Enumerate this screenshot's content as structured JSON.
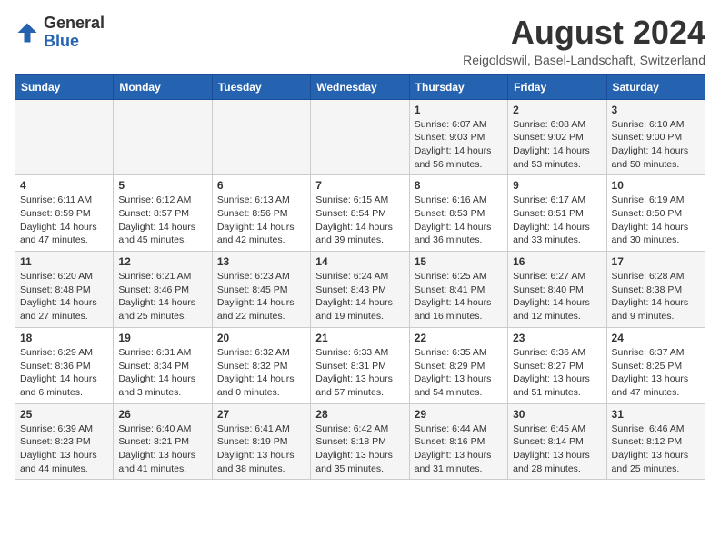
{
  "header": {
    "logo_general": "General",
    "logo_blue": "Blue",
    "month_title": "August 2024",
    "subtitle": "Reigoldswil, Basel-Landschaft, Switzerland"
  },
  "days_of_week": [
    "Sunday",
    "Monday",
    "Tuesday",
    "Wednesday",
    "Thursday",
    "Friday",
    "Saturday"
  ],
  "weeks": [
    [
      {
        "day": "",
        "info": ""
      },
      {
        "day": "",
        "info": ""
      },
      {
        "day": "",
        "info": ""
      },
      {
        "day": "",
        "info": ""
      },
      {
        "day": "1",
        "info": "Sunrise: 6:07 AM\nSunset: 9:03 PM\nDaylight: 14 hours and 56 minutes."
      },
      {
        "day": "2",
        "info": "Sunrise: 6:08 AM\nSunset: 9:02 PM\nDaylight: 14 hours and 53 minutes."
      },
      {
        "day": "3",
        "info": "Sunrise: 6:10 AM\nSunset: 9:00 PM\nDaylight: 14 hours and 50 minutes."
      }
    ],
    [
      {
        "day": "4",
        "info": "Sunrise: 6:11 AM\nSunset: 8:59 PM\nDaylight: 14 hours and 47 minutes."
      },
      {
        "day": "5",
        "info": "Sunrise: 6:12 AM\nSunset: 8:57 PM\nDaylight: 14 hours and 45 minutes."
      },
      {
        "day": "6",
        "info": "Sunrise: 6:13 AM\nSunset: 8:56 PM\nDaylight: 14 hours and 42 minutes."
      },
      {
        "day": "7",
        "info": "Sunrise: 6:15 AM\nSunset: 8:54 PM\nDaylight: 14 hours and 39 minutes."
      },
      {
        "day": "8",
        "info": "Sunrise: 6:16 AM\nSunset: 8:53 PM\nDaylight: 14 hours and 36 minutes."
      },
      {
        "day": "9",
        "info": "Sunrise: 6:17 AM\nSunset: 8:51 PM\nDaylight: 14 hours and 33 minutes."
      },
      {
        "day": "10",
        "info": "Sunrise: 6:19 AM\nSunset: 8:50 PM\nDaylight: 14 hours and 30 minutes."
      }
    ],
    [
      {
        "day": "11",
        "info": "Sunrise: 6:20 AM\nSunset: 8:48 PM\nDaylight: 14 hours and 27 minutes."
      },
      {
        "day": "12",
        "info": "Sunrise: 6:21 AM\nSunset: 8:46 PM\nDaylight: 14 hours and 25 minutes."
      },
      {
        "day": "13",
        "info": "Sunrise: 6:23 AM\nSunset: 8:45 PM\nDaylight: 14 hours and 22 minutes."
      },
      {
        "day": "14",
        "info": "Sunrise: 6:24 AM\nSunset: 8:43 PM\nDaylight: 14 hours and 19 minutes."
      },
      {
        "day": "15",
        "info": "Sunrise: 6:25 AM\nSunset: 8:41 PM\nDaylight: 14 hours and 16 minutes."
      },
      {
        "day": "16",
        "info": "Sunrise: 6:27 AM\nSunset: 8:40 PM\nDaylight: 14 hours and 12 minutes."
      },
      {
        "day": "17",
        "info": "Sunrise: 6:28 AM\nSunset: 8:38 PM\nDaylight: 14 hours and 9 minutes."
      }
    ],
    [
      {
        "day": "18",
        "info": "Sunrise: 6:29 AM\nSunset: 8:36 PM\nDaylight: 14 hours and 6 minutes."
      },
      {
        "day": "19",
        "info": "Sunrise: 6:31 AM\nSunset: 8:34 PM\nDaylight: 14 hours and 3 minutes."
      },
      {
        "day": "20",
        "info": "Sunrise: 6:32 AM\nSunset: 8:32 PM\nDaylight: 14 hours and 0 minutes."
      },
      {
        "day": "21",
        "info": "Sunrise: 6:33 AM\nSunset: 8:31 PM\nDaylight: 13 hours and 57 minutes."
      },
      {
        "day": "22",
        "info": "Sunrise: 6:35 AM\nSunset: 8:29 PM\nDaylight: 13 hours and 54 minutes."
      },
      {
        "day": "23",
        "info": "Sunrise: 6:36 AM\nSunset: 8:27 PM\nDaylight: 13 hours and 51 minutes."
      },
      {
        "day": "24",
        "info": "Sunrise: 6:37 AM\nSunset: 8:25 PM\nDaylight: 13 hours and 47 minutes."
      }
    ],
    [
      {
        "day": "25",
        "info": "Sunrise: 6:39 AM\nSunset: 8:23 PM\nDaylight: 13 hours and 44 minutes."
      },
      {
        "day": "26",
        "info": "Sunrise: 6:40 AM\nSunset: 8:21 PM\nDaylight: 13 hours and 41 minutes."
      },
      {
        "day": "27",
        "info": "Sunrise: 6:41 AM\nSunset: 8:19 PM\nDaylight: 13 hours and 38 minutes."
      },
      {
        "day": "28",
        "info": "Sunrise: 6:42 AM\nSunset: 8:18 PM\nDaylight: 13 hours and 35 minutes."
      },
      {
        "day": "29",
        "info": "Sunrise: 6:44 AM\nSunset: 8:16 PM\nDaylight: 13 hours and 31 minutes."
      },
      {
        "day": "30",
        "info": "Sunrise: 6:45 AM\nSunset: 8:14 PM\nDaylight: 13 hours and 28 minutes."
      },
      {
        "day": "31",
        "info": "Sunrise: 6:46 AM\nSunset: 8:12 PM\nDaylight: 13 hours and 25 minutes."
      }
    ]
  ]
}
